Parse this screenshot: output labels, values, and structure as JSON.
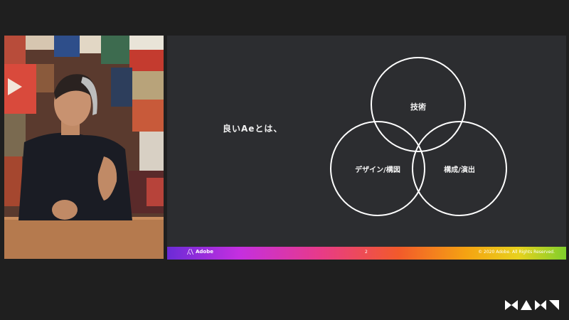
{
  "slide": {
    "title": "良いAeとは、",
    "circles": {
      "top": "技術",
      "left": "デザイン/構図",
      "right": "構成/演出"
    },
    "footer": {
      "brand": "Adobe",
      "page": "2",
      "copyright": "© 2020 Adobe. All Rights Reserved."
    }
  },
  "colors": {
    "background": "#1f1f1f",
    "slide_background": "#2c2d30",
    "text": "#f2f2f2"
  }
}
